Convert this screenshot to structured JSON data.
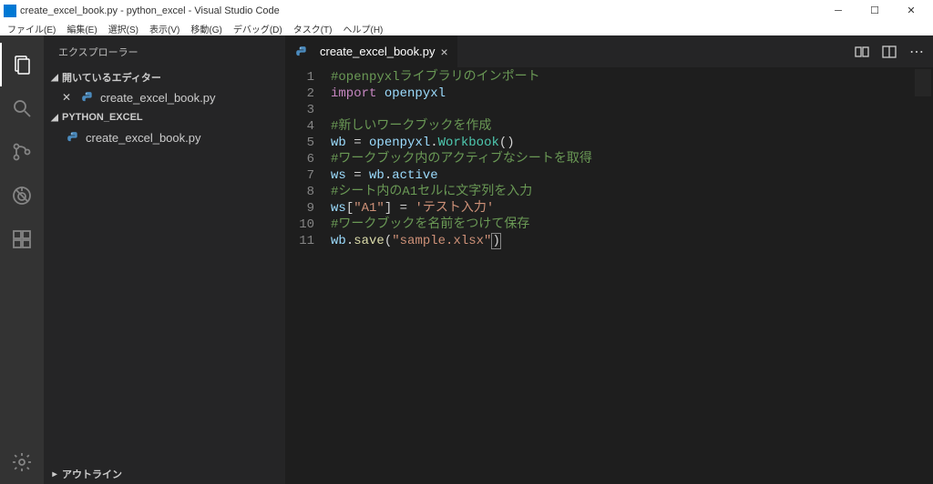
{
  "window": {
    "title": "create_excel_book.py - python_excel - Visual Studio Code"
  },
  "menubar": {
    "items": [
      "ファイル(E)",
      "編集(E)",
      "選択(S)",
      "表示(V)",
      "移動(G)",
      "デバッグ(D)",
      "タスク(T)",
      "ヘルプ(H)"
    ]
  },
  "sidebar": {
    "title": "エクスプローラー",
    "sections": {
      "openEditors": {
        "label": "開いているエディター",
        "items": [
          {
            "name": "create_excel_book.py"
          }
        ]
      },
      "workspace": {
        "label": "PYTHON_EXCEL",
        "items": [
          {
            "name": "create_excel_book.py"
          }
        ]
      },
      "outline": {
        "label": "アウトライン"
      }
    }
  },
  "tabs": [
    {
      "name": "create_excel_book.py"
    }
  ],
  "editor": {
    "lineNumbers": [
      "1",
      "2",
      "3",
      "4",
      "5",
      "6",
      "7",
      "8",
      "9",
      "10",
      "11"
    ],
    "code": [
      {
        "tokens": [
          {
            "t": "comment",
            "v": "#openpyxlライブラリのインポート"
          }
        ]
      },
      {
        "tokens": [
          {
            "t": "keyword",
            "v": "import"
          },
          {
            "t": "punct",
            "v": " "
          },
          {
            "t": "ident",
            "v": "openpyxl"
          }
        ]
      },
      {
        "tokens": []
      },
      {
        "tokens": [
          {
            "t": "comment",
            "v": "#新しいワークブックを作成"
          }
        ]
      },
      {
        "tokens": [
          {
            "t": "ident",
            "v": "wb"
          },
          {
            "t": "punct",
            "v": " = "
          },
          {
            "t": "ident",
            "v": "openpyxl"
          },
          {
            "t": "punct",
            "v": "."
          },
          {
            "t": "class",
            "v": "Workbook"
          },
          {
            "t": "punct",
            "v": "()"
          }
        ]
      },
      {
        "tokens": [
          {
            "t": "comment",
            "v": "#ワークブック内のアクティブなシートを取得"
          }
        ]
      },
      {
        "tokens": [
          {
            "t": "ident",
            "v": "ws"
          },
          {
            "t": "punct",
            "v": " = "
          },
          {
            "t": "ident",
            "v": "wb"
          },
          {
            "t": "punct",
            "v": "."
          },
          {
            "t": "ident",
            "v": "active"
          }
        ]
      },
      {
        "tokens": [
          {
            "t": "comment",
            "v": "#シート内のA1セルに文字列を入力"
          }
        ]
      },
      {
        "tokens": [
          {
            "t": "ident",
            "v": "ws"
          },
          {
            "t": "punct",
            "v": "["
          },
          {
            "t": "string",
            "v": "\"A1\""
          },
          {
            "t": "punct",
            "v": "] = "
          },
          {
            "t": "string",
            "v": "'テスト入力'"
          }
        ]
      },
      {
        "tokens": [
          {
            "t": "comment",
            "v": "#ワークブックを名前をつけて保存"
          }
        ]
      },
      {
        "tokens": [
          {
            "t": "ident",
            "v": "wb"
          },
          {
            "t": "punct",
            "v": "."
          },
          {
            "t": "func",
            "v": "save"
          },
          {
            "t": "punct",
            "v": "("
          },
          {
            "t": "string",
            "v": "\"sample.xlsx\""
          },
          {
            "t": "punct",
            "v": ")",
            "cursor": true
          }
        ]
      }
    ]
  }
}
